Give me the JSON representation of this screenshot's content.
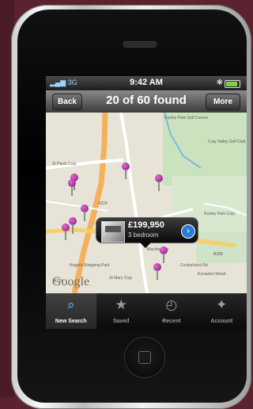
{
  "status_bar": {
    "network": "3G",
    "time": "9:42 AM"
  },
  "nav": {
    "back": "Back",
    "title": "20 of 60 found",
    "more": "More"
  },
  "map": {
    "labels": [
      "St Pauls Cray",
      "A224",
      "Nugent Shopping Park",
      "A224",
      "St Mary Cray",
      "Ruxley Park Golf Course",
      "Cray Valley Golf Club",
      "Blackfen Rd",
      "Cockerhurst Rd",
      "Ruxley Park Cray",
      "B258",
      "Kynaston Wood"
    ],
    "google_logo": "Google",
    "pin_icon": "map-pin-icon"
  },
  "callout": {
    "price": "£199,950",
    "bedrooms": "3 bedroom",
    "disclosure_icon": "chevron-right-icon"
  },
  "tabs": [
    {
      "label": "New Search",
      "icon": "search-icon",
      "active": true
    },
    {
      "label": "Saved",
      "icon": "star-icon",
      "active": false
    },
    {
      "label": "Recent",
      "icon": "clock-icon",
      "active": false
    },
    {
      "label": "Account",
      "icon": "bird-icon",
      "active": false
    }
  ],
  "colors": {
    "accent": "#2b7bd8",
    "pin": "#9b1e86",
    "road": "#f4b15a"
  }
}
